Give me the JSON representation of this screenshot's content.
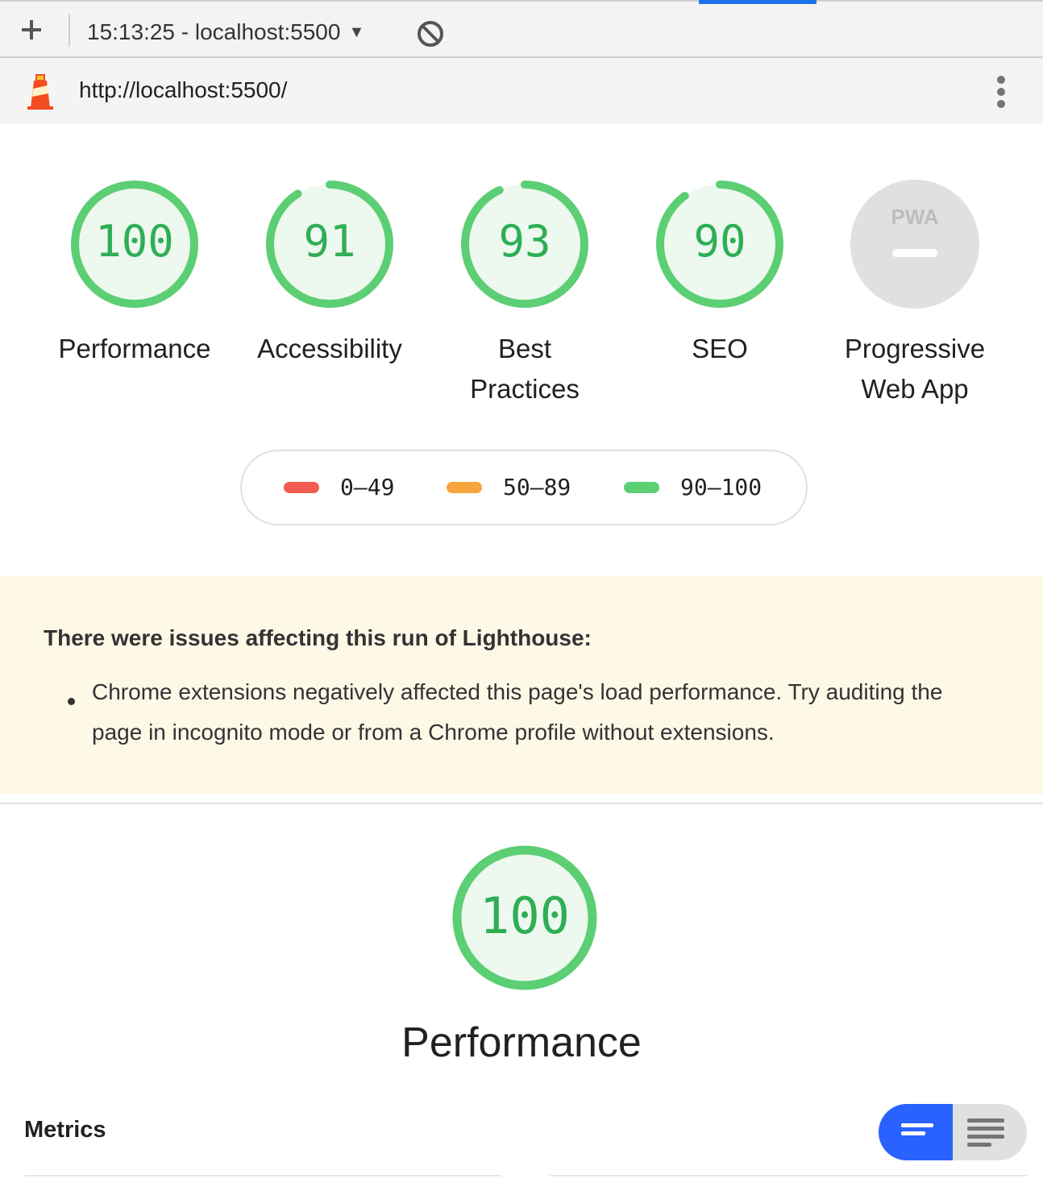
{
  "toolbar": {
    "report_selector": "15:13:25 - localhost:5500",
    "icons": [
      "plus-icon",
      "caret-down-icon",
      "block-icon"
    ]
  },
  "urlbar": {
    "url": "http://localhost:5500/",
    "icons": [
      "lighthouse-logo-icon",
      "kebab-menu-icon"
    ]
  },
  "gauges": [
    {
      "label_line1": "Performance",
      "label_line2": "",
      "score": "100",
      "value": 100
    },
    {
      "label_line1": "Accessibility",
      "label_line2": "",
      "score": "91",
      "value": 91
    },
    {
      "label_line1": "Best",
      "label_line2": "Practices",
      "score": "93",
      "value": 93
    },
    {
      "label_line1": "SEO",
      "label_line2": "",
      "score": "90",
      "value": 90
    },
    {
      "label_line1": "Progressive",
      "label_line2": "Web App",
      "score": "",
      "value": null
    }
  ],
  "legend": [
    {
      "range": "0–49",
      "color": "#f25c4e"
    },
    {
      "range": "50–89",
      "color": "#f6a43b"
    },
    {
      "range": "90–100",
      "color": "#5cce74"
    }
  ],
  "warning": {
    "title": "There were issues affecting this run of Lighthouse:",
    "items": [
      "Chrome extensions negatively affected this page's load performance. Try auditing the page in incognito mode or from a Chrome profile without extensions."
    ]
  },
  "performance": {
    "score": "100",
    "value": 100,
    "title": "Performance"
  },
  "metrics": {
    "label": "Metrics"
  },
  "colors": {
    "pass": "#0cce6b",
    "pass_text": "#2fae55",
    "warning_bg": "#fef8e7",
    "accent": "#2962ff"
  }
}
